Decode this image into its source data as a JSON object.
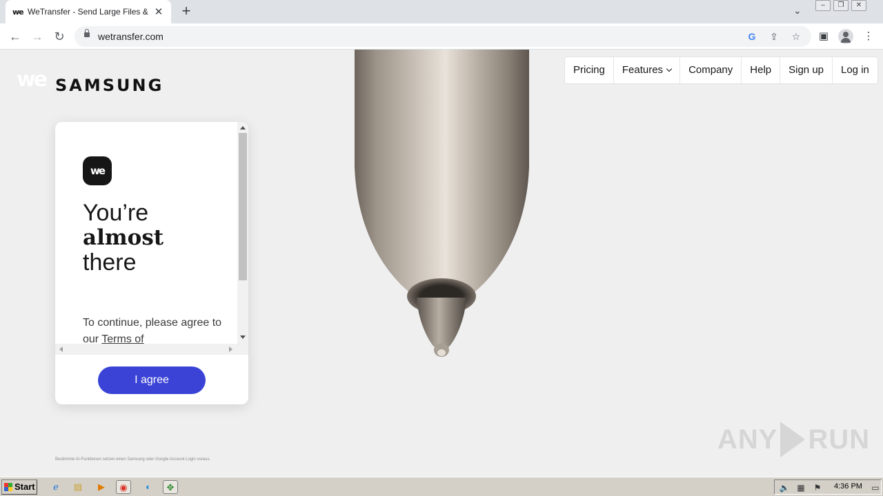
{
  "browser": {
    "tab_title": "WeTransfer - Send Large Files & Sha",
    "tab_favicon": "we",
    "tab_close": "✕",
    "new_tab": "+",
    "tab_dropdown": "⌄",
    "url": "wetransfer.com",
    "back": "←",
    "forward": "→",
    "reload": "↻"
  },
  "site": {
    "we_logo": "we",
    "partner_logo": "SAMSUNG",
    "nav": [
      "Pricing",
      "Features",
      "Company",
      "Help",
      "Sign up",
      "Log in"
    ]
  },
  "consent": {
    "icon_text": "we",
    "heading_line1": "You’re",
    "heading_line2": "almost",
    "heading_line3": "there",
    "body_prefix": "To continue, please agree to our ",
    "body_link": "Terms of",
    "agree_label": "I agree"
  },
  "footnote": "Bestimmte AI-Funktionen setzen einen Samsung oder Google Account Login voraus.",
  "watermark": {
    "left": "ANY",
    "right": "RUN"
  },
  "taskbar": {
    "start_label": "Start",
    "clock": "4:36 PM"
  },
  "colors": {
    "agree_button": "#3a43d6",
    "page_background": "#efefef"
  }
}
